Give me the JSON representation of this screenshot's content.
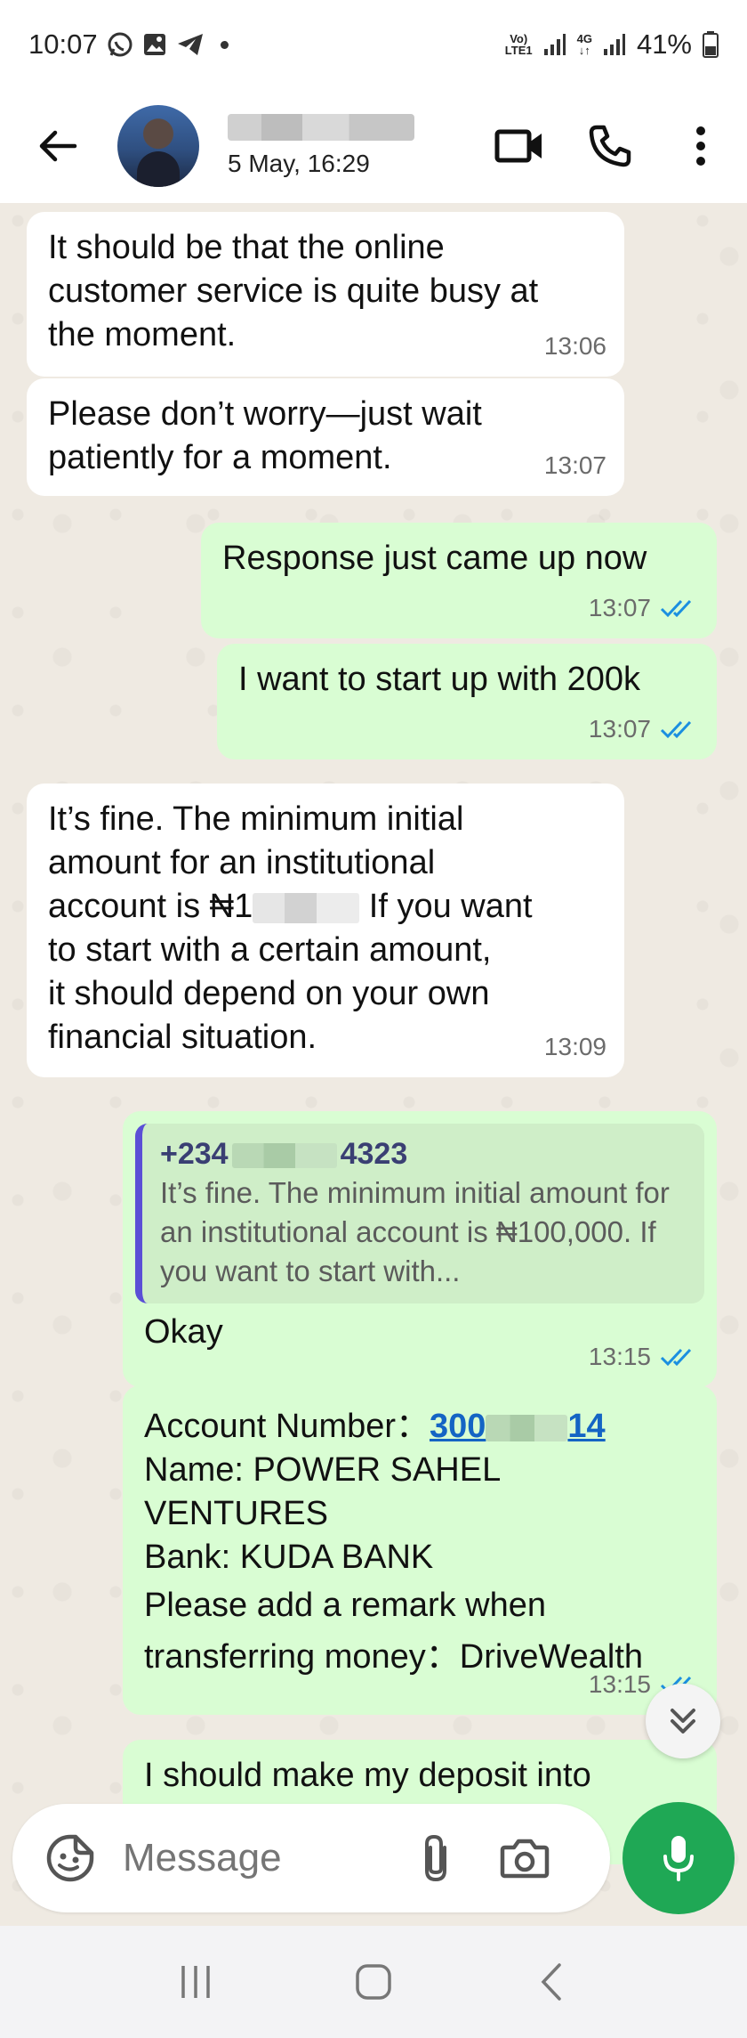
{
  "status_bar": {
    "time": "10:07",
    "battery": "41%",
    "network_top": "Vo)",
    "network_bottom": "LTE1",
    "net4g_top": "4G",
    "net4g_bottom": "↓↑",
    "icons": [
      "whatsapp-icon",
      "gallery-icon",
      "telegram-icon",
      "dot-icon",
      "signal-icon",
      "battery-icon"
    ]
  },
  "header": {
    "last_seen": "5 May, 16:29",
    "icons": [
      "back-arrow-icon",
      "video-call-icon",
      "phone-icon",
      "more-vert-icon"
    ]
  },
  "messages": [
    {
      "direction": "in",
      "text": "It should be that the online\ncustomer service is quite busy at\nthe moment.",
      "time": "13:06"
    },
    {
      "direction": "in",
      "text": "Please don’t worry—just wait\npatiently for a moment.",
      "time": "13:07"
    },
    {
      "direction": "out",
      "text": "Response just came up now",
      "time": "13:07"
    },
    {
      "direction": "out",
      "text": "I want to start up with 200k",
      "time": "13:07"
    },
    {
      "direction": "in",
      "text_part1": "It’s fine. The minimum initial\namount for an institutional\naccount is ₦1",
      "text_part2": " If you want\nto start with a certain amount,\nit should depend on your own\nfinancial situation.",
      "time": "13:09"
    },
    {
      "direction": "out",
      "quote_author_prefix": "+234",
      "quote_author_suffix": "4323",
      "quote_text": "It’s fine. The minimum initial amount for an institutional account is ₦100,000. If you want to start with...",
      "text": "Okay",
      "time": "13:15"
    },
    {
      "direction": "out",
      "acct_label": "Account Number：",
      "acct_prefix": "300",
      "acct_suffix": "14",
      "line2": "Name: POWER SAHEL\nVENTURES",
      "line3": "Bank: KUDA BANK",
      "line4": "Please add a remark when\ntransferring money：DriveWealth",
      "time": "13:15"
    },
    {
      "direction": "out",
      "text": "I should make my deposit into",
      "time": ""
    }
  ],
  "input": {
    "placeholder": "Message"
  },
  "colors": {
    "incoming_bubble": "#ffffff",
    "outgoing_bubble": "#d9fdd3",
    "chat_bg": "#efeae2",
    "mic_button": "#1fa855",
    "read_ticks": "#1b8fe0",
    "quote_bar": "#5b4fd6",
    "link": "#1464c4"
  }
}
